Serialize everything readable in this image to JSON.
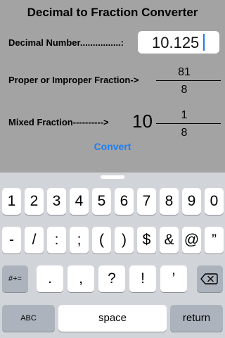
{
  "app": {
    "title": "Decimal to Fraction Converter",
    "decimal_label": "Decimal Number................:",
    "decimal_value": "10.125",
    "proper_label": "Proper or Improper Fraction->",
    "proper_numerator": "81",
    "proper_denominator": "8",
    "mixed_label": "Mixed Fraction---------->",
    "mixed_whole": "10",
    "mixed_numerator": "1",
    "mixed_denominator": "8",
    "convert_label": "Convert",
    "accent_color": "#1f7ef5"
  },
  "keyboard": {
    "row1": [
      "1",
      "2",
      "3",
      "4",
      "5",
      "6",
      "7",
      "8",
      "9",
      "0"
    ],
    "row2": [
      "-",
      "/",
      ":",
      ";",
      "(",
      ")",
      "$",
      "&",
      "@",
      "”"
    ],
    "row3_left": "#+=",
    "row3": [
      ".",
      ",",
      "?",
      "!",
      "’"
    ],
    "row4": {
      "abc": "ABC",
      "space": "space",
      "return": "return"
    },
    "backspace_icon": "backspace-icon"
  }
}
